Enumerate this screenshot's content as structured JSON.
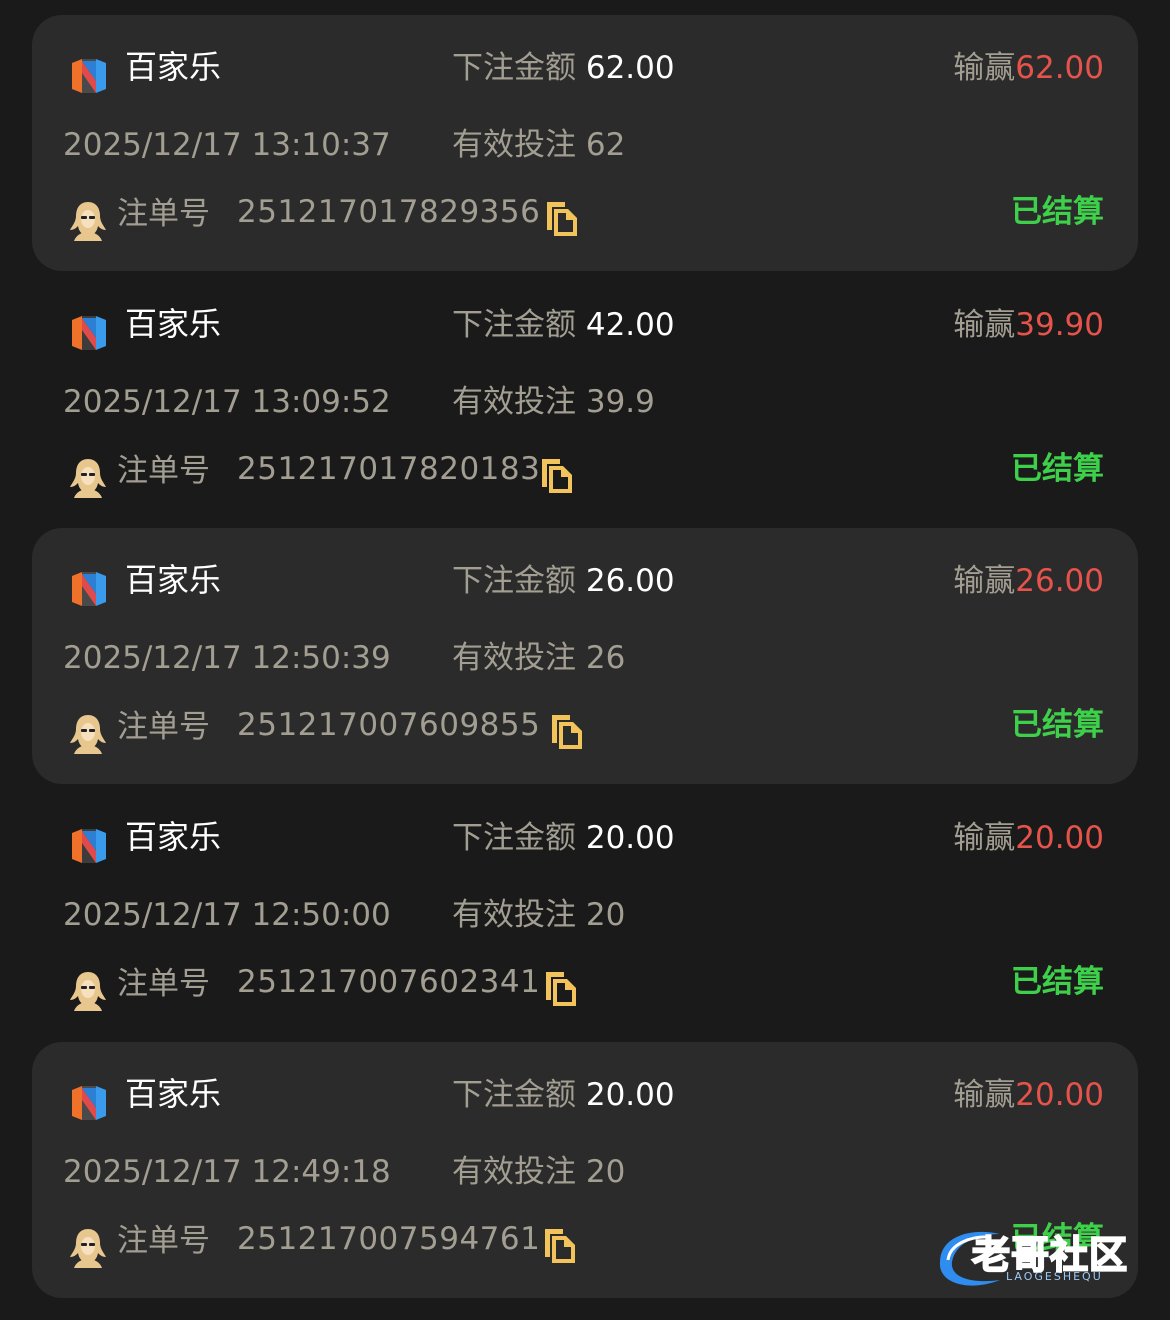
{
  "colors": {
    "background": "#1a1a1a",
    "card": "#2b2b2b",
    "muted_text": "#a39e92",
    "winloss": "#e5534b",
    "settled": "#3ed04a",
    "copy_icon": "#f2c35a"
  },
  "labels": {
    "bet_amount": "下注金额",
    "win_loss": "输赢",
    "valid_bet": "有效投注",
    "order_no": "注单号"
  },
  "bets": [
    {
      "game": "百家乐",
      "bet_amount": "62.00",
      "win_loss": "62.00",
      "time": "2025/12/17 13:10:37",
      "valid_bet": "62",
      "order_no": "251217017829356",
      "status": "已结算",
      "icon": "game-logo-icon"
    },
    {
      "game": "百家乐",
      "bet_amount": "42.00",
      "win_loss": "39.90",
      "time": "2025/12/17 13:09:52",
      "valid_bet": "39.9",
      "order_no": "251217017820183",
      "status": "已结算",
      "icon": "game-logo-icon"
    },
    {
      "game": "百家乐",
      "bet_amount": "26.00",
      "win_loss": "26.00",
      "time": "2025/12/17 12:50:39",
      "valid_bet": "26",
      "order_no": "251217007609855",
      "status": "已结算",
      "icon": "game-logo-icon"
    },
    {
      "game": "百家乐",
      "bet_amount": "20.00",
      "win_loss": "20.00",
      "time": "2025/12/17 12:50:00",
      "valid_bet": "20",
      "order_no": "251217007602341",
      "status": "已结算",
      "icon": "game-logo-icon"
    },
    {
      "game": "百家乐",
      "bet_amount": "20.00",
      "win_loss": "20.00",
      "time": "2025/12/17 12:49:18",
      "valid_bet": "20",
      "order_no": "251217007594761",
      "status": "已结算",
      "icon": "game-logo-icon"
    }
  ],
  "watermark": {
    "title": "老哥社区",
    "subtitle": "LAOGESHEQU"
  }
}
